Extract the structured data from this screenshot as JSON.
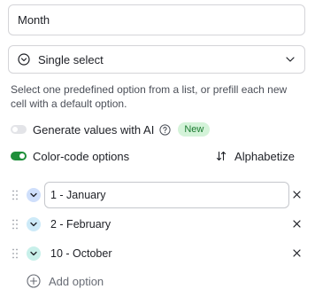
{
  "field": {
    "name_value": "Month",
    "type_label": "Single select",
    "description": "Select one predefined option from a list, or prefill each new cell with a default option."
  },
  "settings": {
    "generate_ai_label": "Generate values with AI",
    "generate_ai_enabled": false,
    "new_badge": "New",
    "color_code_label": "Color-code options",
    "color_code_enabled": true,
    "alphabetize_label": "Alphabetize"
  },
  "options": [
    {
      "label": "1 - January",
      "color": "#cfdffb",
      "focused": true
    },
    {
      "label": "2 - February",
      "color": "#cdeaf8",
      "focused": false
    },
    {
      "label": "10 - October",
      "color": "#c8f0ea",
      "focused": false
    }
  ],
  "add_option_label": "Add option",
  "colors": {
    "accent_toggle": "#1f8f3a",
    "badge_bg": "#d4f3d9",
    "badge_text": "#1a7a30"
  }
}
